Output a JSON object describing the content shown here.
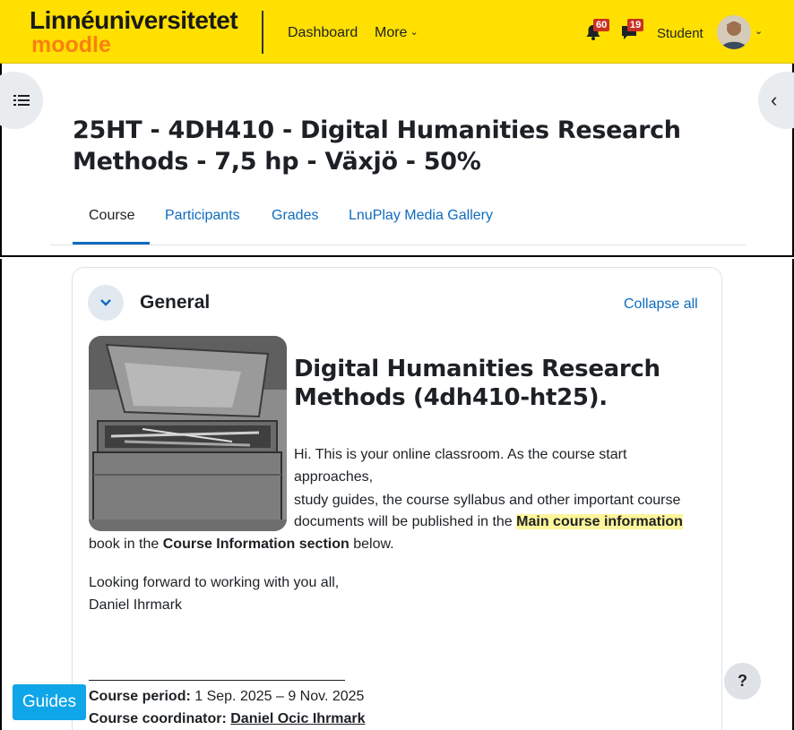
{
  "navbar": {
    "logo_top": "Linnéuniversitetet",
    "logo_bottom": "moodle",
    "dashboard": "Dashboard",
    "more": "More",
    "notifications_count": "60",
    "messages_count": "19",
    "user_label": "Student",
    "brand_color": "#ffe000"
  },
  "header": {
    "title": "25HT - 4DH410 - Digital Humanities Research Methods - 7,5 hp - Växjö - 50%",
    "tabs": [
      {
        "label": "Course",
        "active": true
      },
      {
        "label": "Participants",
        "active": false
      },
      {
        "label": "Grades",
        "active": false
      },
      {
        "label": "LnuPlay Media Gallery",
        "active": false
      }
    ]
  },
  "section": {
    "title": "General",
    "collapse_all": "Collapse all",
    "course_heading": "Digital Humanities Research Methods (4dh410-ht25).",
    "line1": "Hi. This is your online classroom. As the course start",
    "line2": "approaches,",
    "line3": "study guides, the course syllabus and other important course",
    "line4_pre": "documents will be published in the ",
    "line4_highlight": "Main course information",
    "line5_pre": "book in the ",
    "line5_bold": "Course Information section",
    "line5_post": " below.",
    "closing": "Looking forward to working with you all,",
    "signature": "Daniel Ihrmark",
    "period_label": "Course period:",
    "period_value": " 1 Sep. 2025 – 9 Nov. 2025",
    "coordinator_label": "Course coordinator:",
    "coordinator_name": "Daniel Ocic Ihrmark"
  },
  "floating": {
    "guides": "Guides",
    "help": "?"
  }
}
